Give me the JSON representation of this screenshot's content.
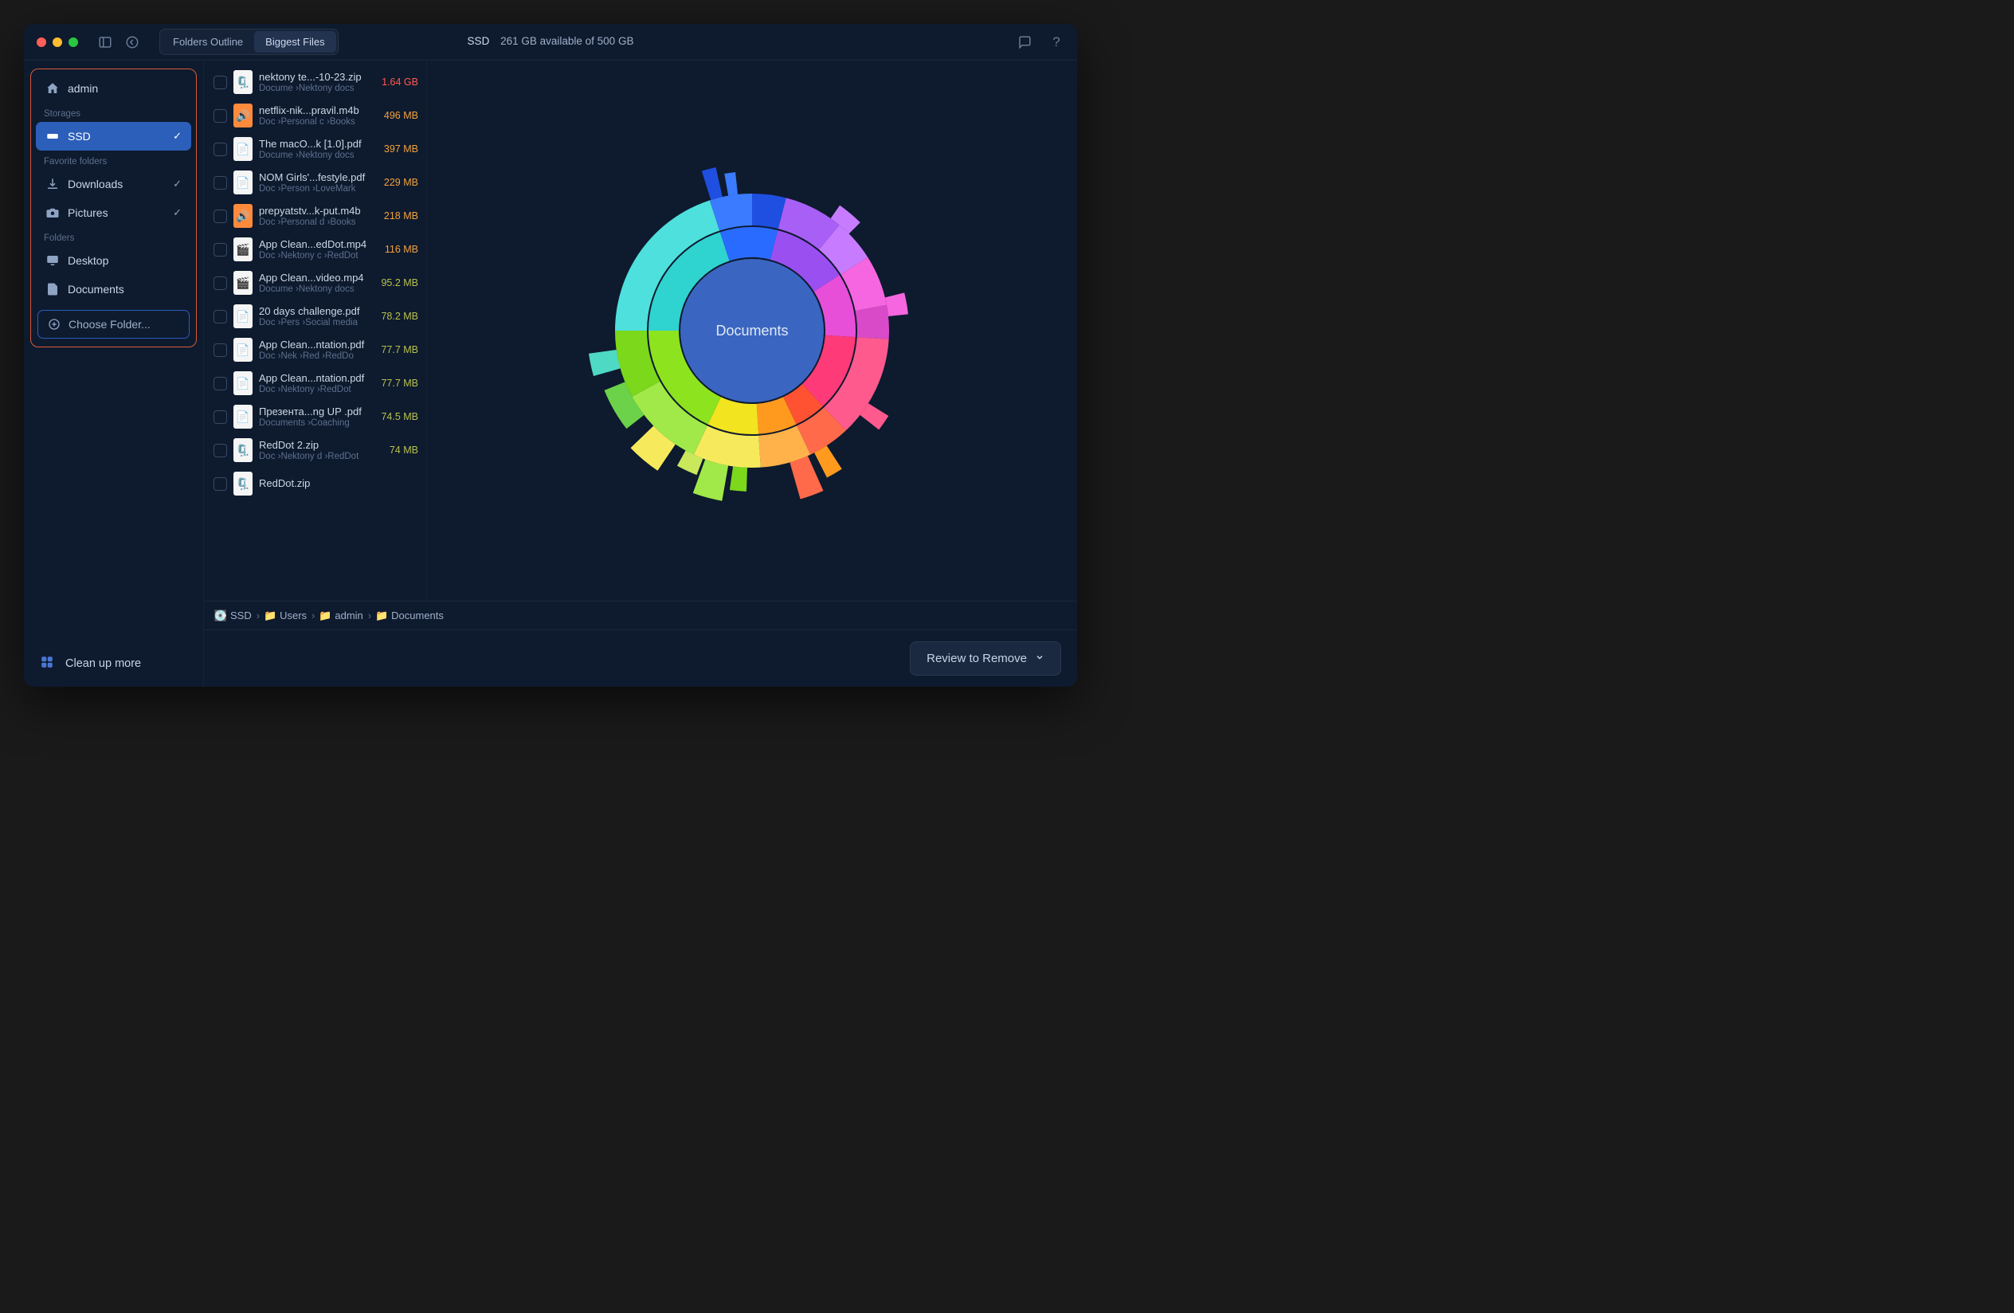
{
  "titlebar": {
    "tabs": [
      "Folders Outline",
      "Biggest Files"
    ],
    "active_tab": 1,
    "drive": "SSD",
    "status": "261 GB available of 500 GB"
  },
  "sidebar": {
    "user": "admin",
    "sections": {
      "storages": {
        "label": "Storages",
        "items": [
          {
            "name": "SSD",
            "selected": true,
            "check": true
          }
        ]
      },
      "favorites": {
        "label": "Favorite folders",
        "items": [
          {
            "name": "Downloads",
            "check": true
          },
          {
            "name": "Pictures",
            "check": true
          }
        ]
      },
      "folders": {
        "label": "Folders",
        "items": [
          {
            "name": "Desktop"
          },
          {
            "name": "Documents"
          }
        ]
      }
    },
    "choose_folder": "Choose Folder...",
    "cleanup": "Clean up more"
  },
  "files": [
    {
      "name": "nektony te...-10-23.zip",
      "path": "Docume ›Nektony docs",
      "size": "1.64 GB",
      "tier": "red",
      "kind": "zip"
    },
    {
      "name": "netflix-nik...pravil.m4b",
      "path": "Doc ›Personal c ›Books",
      "size": "496 MB",
      "tier": "orange",
      "kind": "aud"
    },
    {
      "name": "The macO...k [1.0].pdf",
      "path": "Docume ›Nektony docs",
      "size": "397 MB",
      "tier": "orange",
      "kind": "pdf"
    },
    {
      "name": "NOM Girls'...festyle.pdf",
      "path": "Doc ›Person ›LoveMark",
      "size": "229 MB",
      "tier": "orange",
      "kind": "pdf"
    },
    {
      "name": "prepyatstv...k-put.m4b",
      "path": "Doc ›Personal d ›Books",
      "size": "218 MB",
      "tier": "orange",
      "kind": "aud"
    },
    {
      "name": "App Clean...edDot.mp4",
      "path": "Doc ›Nektony c ›RedDot",
      "size": "116 MB",
      "tier": "orange",
      "kind": "vid"
    },
    {
      "name": "App Clean...video.mp4",
      "path": "Docume ›Nektony docs",
      "size": "95.2 MB",
      "tier": "yellow",
      "kind": "vid"
    },
    {
      "name": "20 days challenge.pdf",
      "path": "Doc ›Pers ›Social media",
      "size": "78.2 MB",
      "tier": "yellow",
      "kind": "pdf"
    },
    {
      "name": "App Clean...ntation.pdf",
      "path": "Doc ›Nek ›Red ›RedDo",
      "size": "77.7 MB",
      "tier": "yellow",
      "kind": "pdf"
    },
    {
      "name": "App Clean...ntation.pdf",
      "path": "Doc ›Nektony ›RedDot",
      "size": "77.7 MB",
      "tier": "yellow",
      "kind": "pdf"
    },
    {
      "name": "Презента...ng UP .pdf",
      "path": "Documents ›Coaching",
      "size": "74.5 MB",
      "tier": "yellow",
      "kind": "pdf"
    },
    {
      "name": "RedDot 2.zip",
      "path": "Doc ›Nektony d ›RedDot",
      "size": "74 MB",
      "tier": "yellow",
      "kind": "zip"
    },
    {
      "name": "RedDot.zip",
      "path": "",
      "size": "",
      "tier": "yellow",
      "kind": "zip"
    }
  ],
  "breadcrumb": [
    "SSD",
    "Users",
    "admin",
    "Documents"
  ],
  "chart": {
    "center": "Documents"
  },
  "chart_data": {
    "type": "sunburst",
    "title": "Documents",
    "unit": "relative-size",
    "rings": [
      {
        "level": 1,
        "segments": [
          {
            "name": "cyan",
            "fraction": 0.2,
            "color": "#2fd3d0"
          },
          {
            "name": "blue",
            "fraction": 0.09,
            "color": "#2a6bff"
          },
          {
            "name": "purple",
            "fraction": 0.12,
            "color": "#9a4ff0"
          },
          {
            "name": "magenta",
            "fraction": 0.1,
            "color": "#e84fd8"
          },
          {
            "name": "pink",
            "fraction": 0.12,
            "color": "#ff3a78"
          },
          {
            "name": "red",
            "fraction": 0.05,
            "color": "#ff5232"
          },
          {
            "name": "orange",
            "fraction": 0.06,
            "color": "#ff9a1f"
          },
          {
            "name": "yellow",
            "fraction": 0.08,
            "color": "#f2e41e"
          },
          {
            "name": "lime",
            "fraction": 0.18,
            "color": "#8de31e"
          }
        ]
      },
      {
        "level": 2,
        "segments": [
          {
            "name": "cyan-outer",
            "fraction": 0.2,
            "color": "#4ee0dc"
          },
          {
            "name": "blue-a",
            "fraction": 0.05,
            "color": "#3a7bff"
          },
          {
            "name": "blue-b",
            "fraction": 0.04,
            "color": "#1e4fe0"
          },
          {
            "name": "purple-a",
            "fraction": 0.07,
            "color": "#a85ff5"
          },
          {
            "name": "purple-b",
            "fraction": 0.05,
            "color": "#c77cff"
          },
          {
            "name": "magenta-a",
            "fraction": 0.06,
            "color": "#f566e0"
          },
          {
            "name": "magenta-b",
            "fraction": 0.04,
            "color": "#d94ac9"
          },
          {
            "name": "pink-a",
            "fraction": 0.12,
            "color": "#ff5a8e"
          },
          {
            "name": "red-a",
            "fraction": 0.05,
            "color": "#ff6a4a"
          },
          {
            "name": "orange-a",
            "fraction": 0.06,
            "color": "#ffb24a"
          },
          {
            "name": "yellow-a",
            "fraction": 0.08,
            "color": "#f6ea5c"
          },
          {
            "name": "lime-a",
            "fraction": 0.1,
            "color": "#a0e948"
          },
          {
            "name": "lime-b",
            "fraction": 0.08,
            "color": "#7cd81a"
          }
        ]
      }
    ]
  },
  "footer": {
    "review": "Review to Remove"
  }
}
